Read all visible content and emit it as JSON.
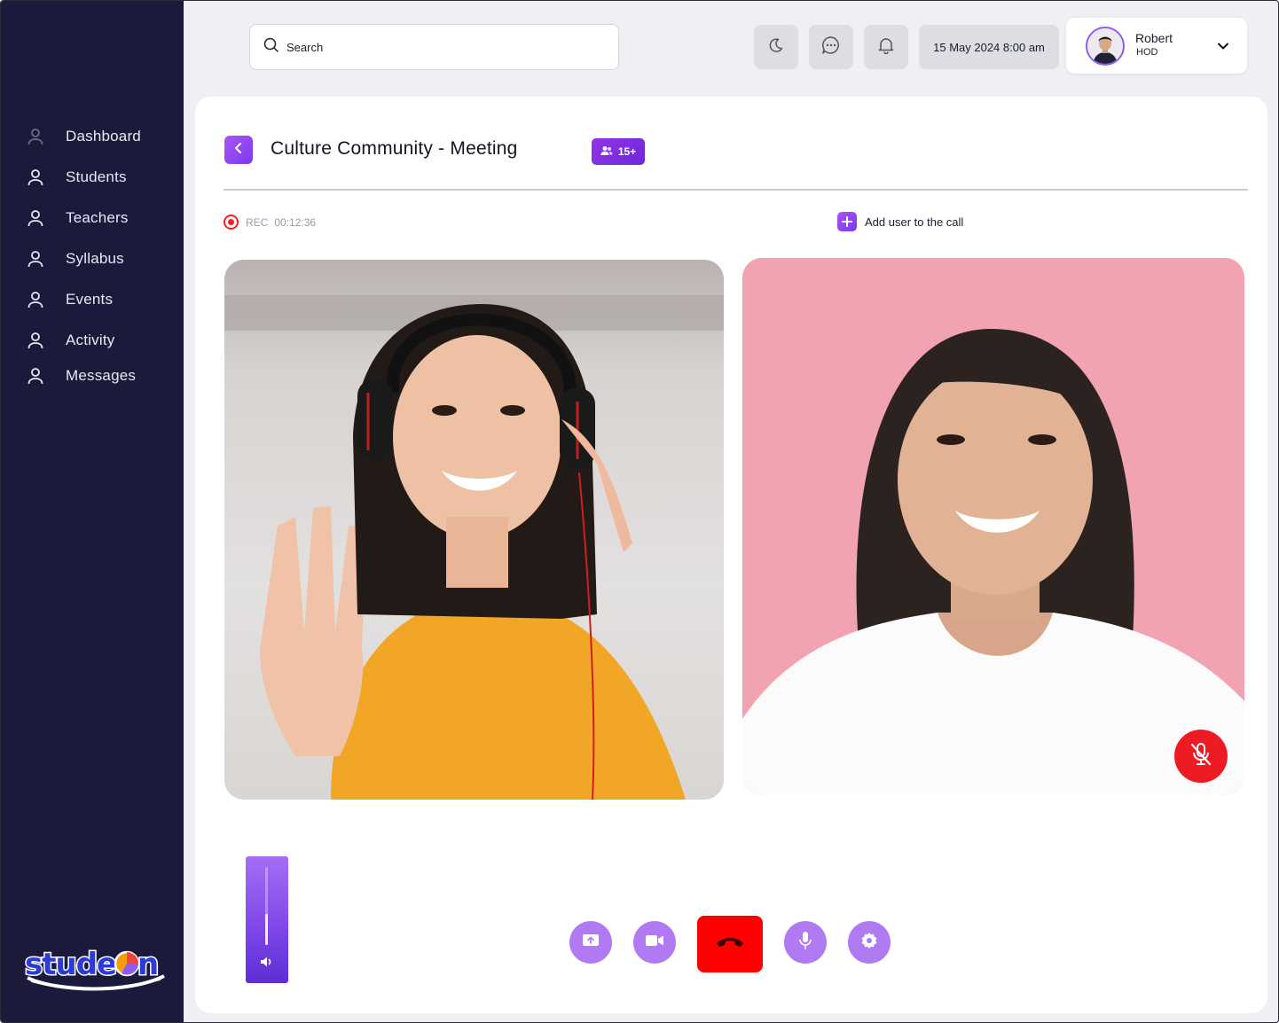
{
  "app": {
    "logo_text": "studeOn"
  },
  "sidebar": {
    "items": [
      {
        "label": "Dashboard"
      },
      {
        "label": "Students"
      },
      {
        "label": "Teachers"
      },
      {
        "label": "Syllabus"
      },
      {
        "label": "Events"
      },
      {
        "label": "Activity"
      },
      {
        "label": "Messages"
      }
    ]
  },
  "header": {
    "search_placeholder": "Search",
    "datetime": "15 May 2024 8:00 am",
    "user": {
      "name": "Robert",
      "role": "HOD"
    },
    "icons": [
      "moon-icon",
      "chat-icon",
      "bell-icon"
    ]
  },
  "meeting": {
    "title": "Culture Community - Meeting",
    "participants_badge": "15+",
    "rec_label": "REC",
    "rec_time": "00:12:36",
    "add_user_label": "Add user to the call",
    "volume_level": 0.4
  },
  "controls": [
    "share-screen-icon",
    "video-camera-icon",
    "end-call-icon",
    "microphone-icon",
    "settings-gear-icon"
  ],
  "colors": {
    "sidebar_bg": "#1c1a3b",
    "accent_purple": "#8b5cf6",
    "control_purple": "#b07af2",
    "end_call_red": "#ff0000",
    "mute_red": "#ee1b24",
    "record_red": "#ff1b1b"
  }
}
